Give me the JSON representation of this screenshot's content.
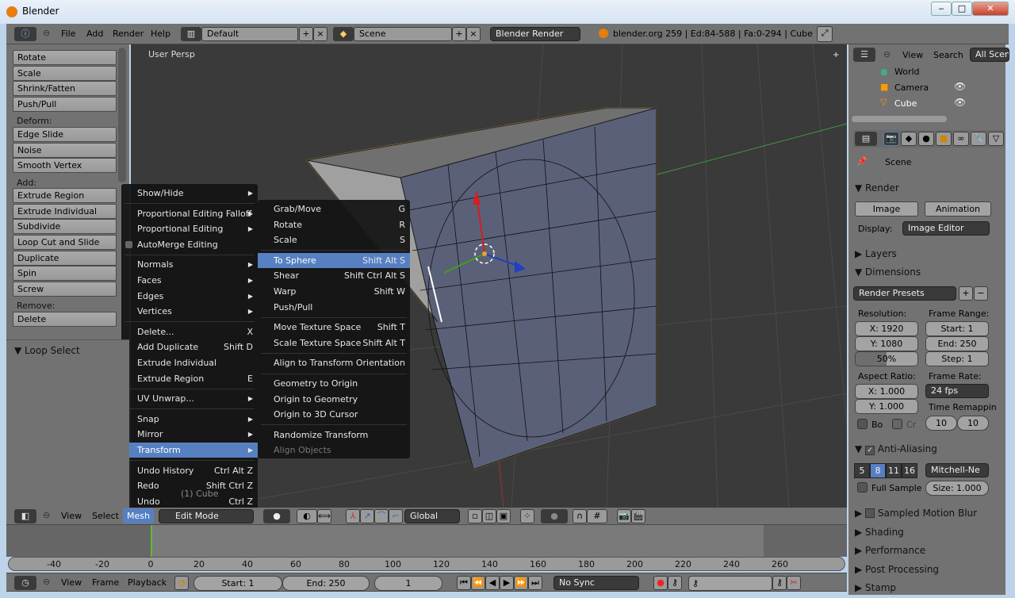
{
  "window": {
    "title": "Blender",
    "minimize": "‒",
    "maximize": "□",
    "close": "✕"
  },
  "info_header": {
    "menus": [
      "File",
      "Add",
      "Render",
      "Help"
    ],
    "layout": "Default",
    "scene": "Scene",
    "engine": "Blender Render",
    "stats": "blender.org 259 | Ed:84-588 | Fa:0-294 | Cube"
  },
  "outliner": {
    "menus": [
      "View",
      "Search"
    ],
    "filter": "All Scenes",
    "items": [
      "World",
      "Camera",
      "Cube"
    ]
  },
  "toolbar": {
    "groups": [
      {
        "label": "",
        "buttons": [
          "Rotate",
          "Scale",
          "Shrink/Fatten",
          "Push/Pull"
        ]
      },
      {
        "label": "Deform:",
        "buttons": [
          "Edge Slide",
          "Noise",
          "Smooth Vertex"
        ]
      },
      {
        "label": "Add:",
        "buttons": [
          "Extrude Region",
          "Extrude Individual",
          "Subdivide",
          "Loop Cut and Slide",
          "Duplicate",
          "Spin",
          "Screw"
        ]
      },
      {
        "label": "Remove:",
        "buttons": [
          "Delete"
        ]
      }
    ],
    "operator_panel": "Loop Select"
  },
  "viewport": {
    "view_label": "User Persp",
    "object_label": "(1) Cube"
  },
  "mesh_menu": {
    "items": [
      {
        "label": "Show/Hide",
        "submenu": true,
        "sep": true
      },
      {
        "label": "Proportional Editing Falloff",
        "submenu": true
      },
      {
        "label": "Proportional Editing",
        "submenu": true
      },
      {
        "label": "AutoMerge Editing",
        "check": true,
        "sep": true
      },
      {
        "label": "Normals",
        "submenu": true
      },
      {
        "label": "Faces",
        "submenu": true
      },
      {
        "label": "Edges",
        "submenu": true
      },
      {
        "label": "Vertices",
        "submenu": true,
        "sep": true
      },
      {
        "label": "Delete...",
        "shortcut": "X"
      },
      {
        "label": "Add Duplicate",
        "shortcut": "Shift D"
      },
      {
        "label": "Extrude Individual"
      },
      {
        "label": "Extrude Region",
        "shortcut": "E",
        "sep": true
      },
      {
        "label": "UV Unwrap...",
        "submenu": true,
        "sep": true
      },
      {
        "label": "Snap",
        "submenu": true
      },
      {
        "label": "Mirror",
        "submenu": true
      },
      {
        "label": "Transform",
        "submenu": true,
        "highlight": true,
        "sep": true
      },
      {
        "label": "Undo History",
        "shortcut": "Ctrl Alt Z"
      },
      {
        "label": "Redo",
        "shortcut": "Shift Ctrl Z"
      },
      {
        "label": "Undo",
        "shortcut": "Ctrl Z"
      }
    ]
  },
  "transform_menu": {
    "items": [
      {
        "label": "Grab/Move",
        "shortcut": "G"
      },
      {
        "label": "Rotate",
        "shortcut": "R"
      },
      {
        "label": "Scale",
        "shortcut": "S",
        "sep": true
      },
      {
        "label": "To Sphere",
        "shortcut": "Shift Alt S",
        "highlight": true
      },
      {
        "label": "Shear",
        "shortcut": "Shift Ctrl Alt S"
      },
      {
        "label": "Warp",
        "shortcut": "Shift W"
      },
      {
        "label": "Push/Pull",
        "sep": true
      },
      {
        "label": "Move Texture Space",
        "shortcut": "Shift T"
      },
      {
        "label": "Scale Texture Space",
        "shortcut": "Shift Alt T",
        "sep": true
      },
      {
        "label": "Align to Transform Orientation",
        "sep": true
      },
      {
        "label": "Geometry to Origin"
      },
      {
        "label": "Origin to Geometry"
      },
      {
        "label": "Origin to 3D Cursor",
        "sep": true
      },
      {
        "label": "Randomize Transform"
      },
      {
        "label": "Align Objects",
        "disabled": true
      }
    ]
  },
  "view3d_header": {
    "menus": [
      "View",
      "Select",
      "Mesh"
    ],
    "mode": "Edit Mode",
    "orientation": "Global"
  },
  "timeline": {
    "ticks": [
      "-40",
      "-20",
      "0",
      "20",
      "40",
      "60",
      "80",
      "100",
      "120",
      "140",
      "160",
      "180",
      "200",
      "220",
      "240",
      "260"
    ],
    "current_frame": 0,
    "header": {
      "menus": [
        "View",
        "Frame",
        "Playback"
      ],
      "start": "Start: 1",
      "end": "End: 250",
      "frame": "1",
      "sync": "No Sync"
    }
  },
  "properties": {
    "scene": "Scene",
    "render": {
      "title": "Render",
      "image": "Image",
      "animation": "Animation",
      "display_label": "Display:",
      "display": "Image Editor"
    },
    "layers": "Layers",
    "dimensions": {
      "title": "Dimensions",
      "presets": "Render Presets",
      "resolution_label": "Resolution:",
      "res_x": "X: 1920",
      "res_y": "Y: 1080",
      "percent": "50%",
      "percent_value": 50,
      "frame_range_label": "Frame Range:",
      "start": "Start: 1",
      "end": "End: 250",
      "step": "Step: 1",
      "aspect_label": "Aspect Ratio:",
      "aspect_x": "X: 1.000",
      "aspect_y": "Y: 1.000",
      "frame_rate_label": "Frame Rate:",
      "frame_rate": "24 fps",
      "border": "Bo",
      "crop": "Cr",
      "time_remap_label": "Time Remappin",
      "remap_old": "10",
      "remap_new": "10"
    },
    "antialiasing": {
      "title": "Anti-Aliasing",
      "samples": [
        "5",
        "8",
        "11",
        "16"
      ],
      "selected": "8",
      "filter": "Mitchell-Ne",
      "full_sample": "Full Sample",
      "size": "Size: 1.000"
    },
    "collapsed": [
      "Sampled Motion Blur",
      "Shading",
      "Performance",
      "Post Processing",
      "Stamp"
    ]
  },
  "colors": {
    "highlight": "#5680c2",
    "selection_outline": "#f0a030",
    "menu_bg": "#141414",
    "viewport_bg": "#3a3a3a"
  }
}
